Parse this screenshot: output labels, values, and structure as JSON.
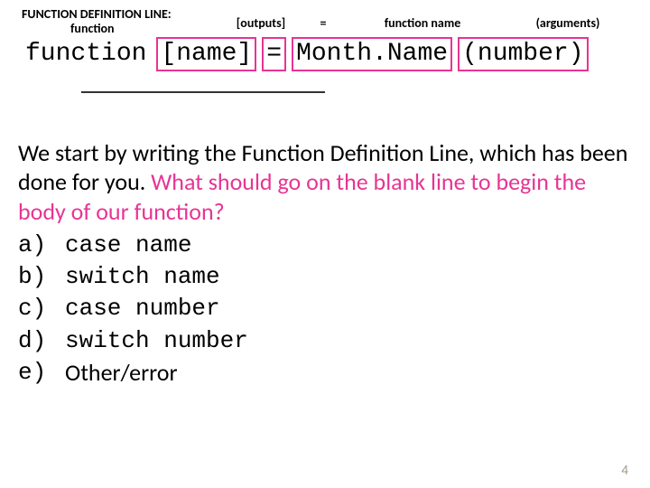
{
  "header": {
    "title_line1": "FUNCTION DEFINITION LINE:",
    "title_line2": "function",
    "col_outputs": "[outputs]",
    "col_equals": "=",
    "col_funcname": "function name",
    "col_args": "(arguments)"
  },
  "code": {
    "keyword": "function",
    "outputs": "[name]",
    "equals": "=",
    "funcname": "Month.Name",
    "args": "(number)"
  },
  "question": {
    "part1": "We start by writing the Function Definition Line, which has been done for you. ",
    "highlight": "What should go on the blank line to begin the body of our function?"
  },
  "options": {
    "a": {
      "letter": "a)",
      "text": "case name"
    },
    "b": {
      "letter": "b)",
      "text": "switch name"
    },
    "c": {
      "letter": "c)",
      "text": "case number"
    },
    "d": {
      "letter": "d)",
      "text": "switch number"
    },
    "e": {
      "letter": "e)",
      "text": "Other/error"
    }
  },
  "page": "4"
}
